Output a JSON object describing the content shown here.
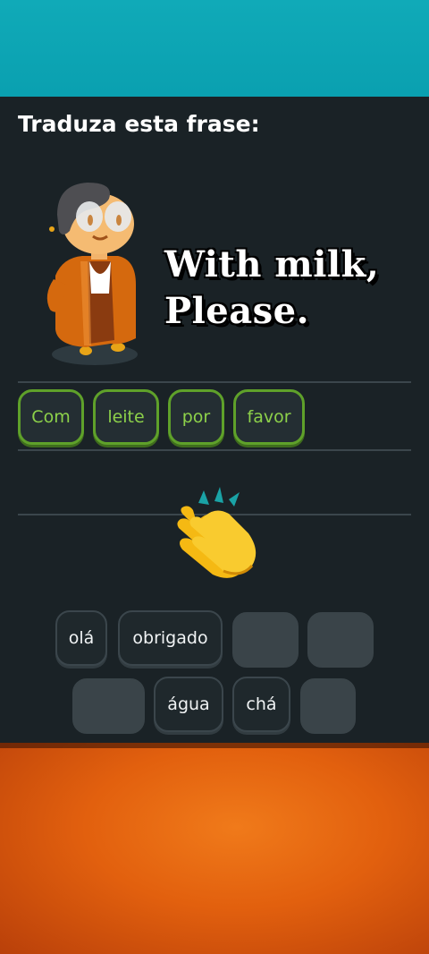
{
  "screen": {
    "title": "Traduza esta frase:",
    "prompt_line1": "With milk,",
    "prompt_line2": "Please."
  },
  "answer": {
    "tokens": [
      "Com",
      "leite",
      "por",
      "favor"
    ]
  },
  "word_bank": {
    "row1": [
      {
        "label": "olá",
        "used": false
      },
      {
        "label": "obrigado",
        "used": false
      },
      {
        "label": "",
        "used": true
      },
      {
        "label": "",
        "used": true
      }
    ],
    "row2": [
      {
        "label": "",
        "used": true
      },
      {
        "label": "água",
        "used": false
      },
      {
        "label": "chá",
        "used": false
      },
      {
        "label": "",
        "used": true
      }
    ]
  },
  "icons": {
    "character": "grandma-character-illustration",
    "feedback": "clapping-hands-emoji"
  },
  "colors": {
    "top_band": "#10aab8",
    "app_background": "#1a2226",
    "selected_border": "#5fa12a",
    "selected_text": "#8dd14a",
    "bottom_band": "#e2600e"
  }
}
